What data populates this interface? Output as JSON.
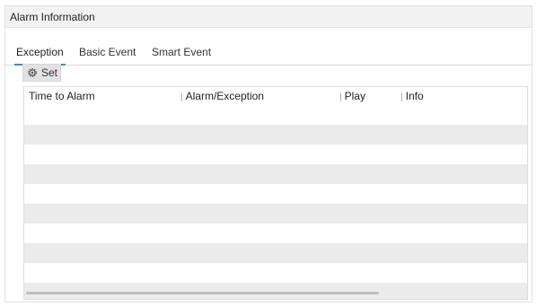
{
  "window": {
    "title": "Alarm Information"
  },
  "tabs": [
    {
      "label": "Exception",
      "active": true
    },
    {
      "label": "Basic Event",
      "active": false
    },
    {
      "label": "Smart Event",
      "active": false
    }
  ],
  "toolbar": {
    "set_label": "Set",
    "set_icon": "gear-icon"
  },
  "table": {
    "columns": [
      "Time to Alarm",
      "Alarm/Exception",
      "Play",
      "Info"
    ],
    "rows": [],
    "scroll": {
      "visible_fraction": 0.7
    }
  },
  "colors": {
    "accent": "#2f8fd6",
    "stripe": "#ebebeb",
    "title_bar": "#f2f2f2"
  }
}
